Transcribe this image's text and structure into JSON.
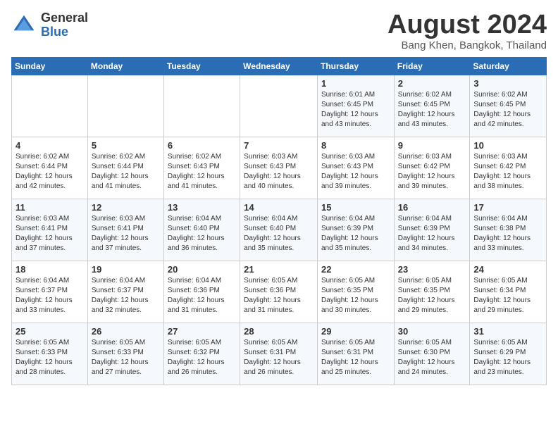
{
  "header": {
    "logo_general": "General",
    "logo_blue": "Blue",
    "month_title": "August 2024",
    "location": "Bang Khen, Bangkok, Thailand"
  },
  "weekdays": [
    "Sunday",
    "Monday",
    "Tuesday",
    "Wednesday",
    "Thursday",
    "Friday",
    "Saturday"
  ],
  "weeks": [
    [
      {
        "day": "",
        "info": ""
      },
      {
        "day": "",
        "info": ""
      },
      {
        "day": "",
        "info": ""
      },
      {
        "day": "",
        "info": ""
      },
      {
        "day": "1",
        "info": "Sunrise: 6:01 AM\nSunset: 6:45 PM\nDaylight: 12 hours\nand 43 minutes."
      },
      {
        "day": "2",
        "info": "Sunrise: 6:02 AM\nSunset: 6:45 PM\nDaylight: 12 hours\nand 43 minutes."
      },
      {
        "day": "3",
        "info": "Sunrise: 6:02 AM\nSunset: 6:45 PM\nDaylight: 12 hours\nand 42 minutes."
      }
    ],
    [
      {
        "day": "4",
        "info": "Sunrise: 6:02 AM\nSunset: 6:44 PM\nDaylight: 12 hours\nand 42 minutes."
      },
      {
        "day": "5",
        "info": "Sunrise: 6:02 AM\nSunset: 6:44 PM\nDaylight: 12 hours\nand 41 minutes."
      },
      {
        "day": "6",
        "info": "Sunrise: 6:02 AM\nSunset: 6:43 PM\nDaylight: 12 hours\nand 41 minutes."
      },
      {
        "day": "7",
        "info": "Sunrise: 6:03 AM\nSunset: 6:43 PM\nDaylight: 12 hours\nand 40 minutes."
      },
      {
        "day": "8",
        "info": "Sunrise: 6:03 AM\nSunset: 6:43 PM\nDaylight: 12 hours\nand 39 minutes."
      },
      {
        "day": "9",
        "info": "Sunrise: 6:03 AM\nSunset: 6:42 PM\nDaylight: 12 hours\nand 39 minutes."
      },
      {
        "day": "10",
        "info": "Sunrise: 6:03 AM\nSunset: 6:42 PM\nDaylight: 12 hours\nand 38 minutes."
      }
    ],
    [
      {
        "day": "11",
        "info": "Sunrise: 6:03 AM\nSunset: 6:41 PM\nDaylight: 12 hours\nand 37 minutes."
      },
      {
        "day": "12",
        "info": "Sunrise: 6:03 AM\nSunset: 6:41 PM\nDaylight: 12 hours\nand 37 minutes."
      },
      {
        "day": "13",
        "info": "Sunrise: 6:04 AM\nSunset: 6:40 PM\nDaylight: 12 hours\nand 36 minutes."
      },
      {
        "day": "14",
        "info": "Sunrise: 6:04 AM\nSunset: 6:40 PM\nDaylight: 12 hours\nand 35 minutes."
      },
      {
        "day": "15",
        "info": "Sunrise: 6:04 AM\nSunset: 6:39 PM\nDaylight: 12 hours\nand 35 minutes."
      },
      {
        "day": "16",
        "info": "Sunrise: 6:04 AM\nSunset: 6:39 PM\nDaylight: 12 hours\nand 34 minutes."
      },
      {
        "day": "17",
        "info": "Sunrise: 6:04 AM\nSunset: 6:38 PM\nDaylight: 12 hours\nand 33 minutes."
      }
    ],
    [
      {
        "day": "18",
        "info": "Sunrise: 6:04 AM\nSunset: 6:37 PM\nDaylight: 12 hours\nand 33 minutes."
      },
      {
        "day": "19",
        "info": "Sunrise: 6:04 AM\nSunset: 6:37 PM\nDaylight: 12 hours\nand 32 minutes."
      },
      {
        "day": "20",
        "info": "Sunrise: 6:04 AM\nSunset: 6:36 PM\nDaylight: 12 hours\nand 31 minutes."
      },
      {
        "day": "21",
        "info": "Sunrise: 6:05 AM\nSunset: 6:36 PM\nDaylight: 12 hours\nand 31 minutes."
      },
      {
        "day": "22",
        "info": "Sunrise: 6:05 AM\nSunset: 6:35 PM\nDaylight: 12 hours\nand 30 minutes."
      },
      {
        "day": "23",
        "info": "Sunrise: 6:05 AM\nSunset: 6:35 PM\nDaylight: 12 hours\nand 29 minutes."
      },
      {
        "day": "24",
        "info": "Sunrise: 6:05 AM\nSunset: 6:34 PM\nDaylight: 12 hours\nand 29 minutes."
      }
    ],
    [
      {
        "day": "25",
        "info": "Sunrise: 6:05 AM\nSunset: 6:33 PM\nDaylight: 12 hours\nand 28 minutes."
      },
      {
        "day": "26",
        "info": "Sunrise: 6:05 AM\nSunset: 6:33 PM\nDaylight: 12 hours\nand 27 minutes."
      },
      {
        "day": "27",
        "info": "Sunrise: 6:05 AM\nSunset: 6:32 PM\nDaylight: 12 hours\nand 26 minutes."
      },
      {
        "day": "28",
        "info": "Sunrise: 6:05 AM\nSunset: 6:31 PM\nDaylight: 12 hours\nand 26 minutes."
      },
      {
        "day": "29",
        "info": "Sunrise: 6:05 AM\nSunset: 6:31 PM\nDaylight: 12 hours\nand 25 minutes."
      },
      {
        "day": "30",
        "info": "Sunrise: 6:05 AM\nSunset: 6:30 PM\nDaylight: 12 hours\nand 24 minutes."
      },
      {
        "day": "31",
        "info": "Sunrise: 6:05 AM\nSunset: 6:29 PM\nDaylight: 12 hours\nand 23 minutes."
      }
    ]
  ]
}
